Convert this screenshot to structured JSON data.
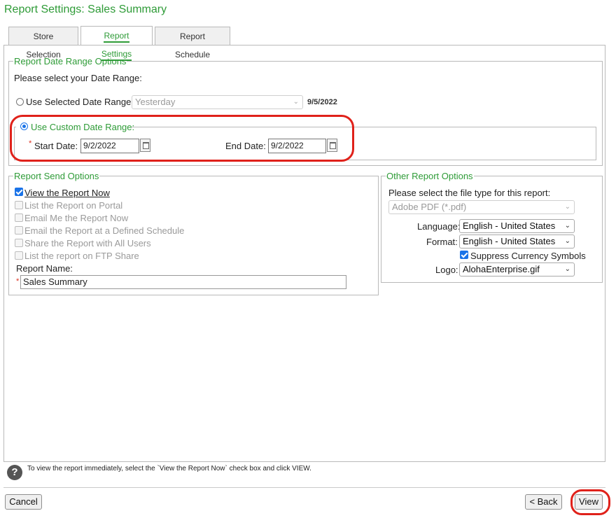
{
  "page_title": "Report Settings: Sales Summary",
  "tabs": [
    {
      "label": "Store Selection",
      "active": false
    },
    {
      "label": "Report Settings",
      "active": true
    },
    {
      "label": "Report Schedule",
      "active": false
    }
  ],
  "date_range": {
    "legend": "Report Date Range Options",
    "prompt": "Please select your Date Range:",
    "selected_option_label": "Use Selected Date Range:",
    "selected_option_value": "Yesterday",
    "selected_option_date": "9/5/2022",
    "custom_legend": "Use Custom Date Range:",
    "required_mark": "*",
    "start_label": "Start Date:",
    "start_value": "9/2/2022",
    "end_label": "End Date:",
    "end_value": "9/2/2022"
  },
  "send_options": {
    "legend": "Report Send Options",
    "items": [
      {
        "label": "View the Report Now",
        "checked": true,
        "enabled": true
      },
      {
        "label": "List the Report on Portal",
        "checked": false,
        "enabled": false
      },
      {
        "label": "Email Me the Report Now",
        "checked": false,
        "enabled": false
      },
      {
        "label": "Email the Report at a Defined Schedule",
        "checked": false,
        "enabled": false
      },
      {
        "label": "Share the Report with All Users",
        "checked": false,
        "enabled": false
      },
      {
        "label": "List the report on FTP Share",
        "checked": false,
        "enabled": false
      }
    ],
    "report_name_label": "Report Name:",
    "required_mark": "*",
    "report_name_value": "Sales Summary"
  },
  "other_options": {
    "legend": "Other Report Options",
    "file_type_prompt": "Please select the file type for this report:",
    "file_type_value": "Adobe PDF (*.pdf)",
    "language_label": "Language:",
    "language_value": "English - United States",
    "format_label": "Format:",
    "format_value": "English - United States",
    "suppress_label": "Suppress Currency Symbols",
    "logo_label": "Logo:",
    "logo_value": "AlohaEnterprise.gif"
  },
  "help_icon": "question-icon",
  "help_text": "To view the report immediately, select the `View the Report Now` check box and click VIEW.",
  "buttons": {
    "cancel": "Cancel",
    "back": "< Back",
    "view": "View"
  },
  "colors": {
    "accent": "#2e9b37",
    "highlight_ring": "#e0211a",
    "radio_checkbox": "#1a73e8"
  }
}
